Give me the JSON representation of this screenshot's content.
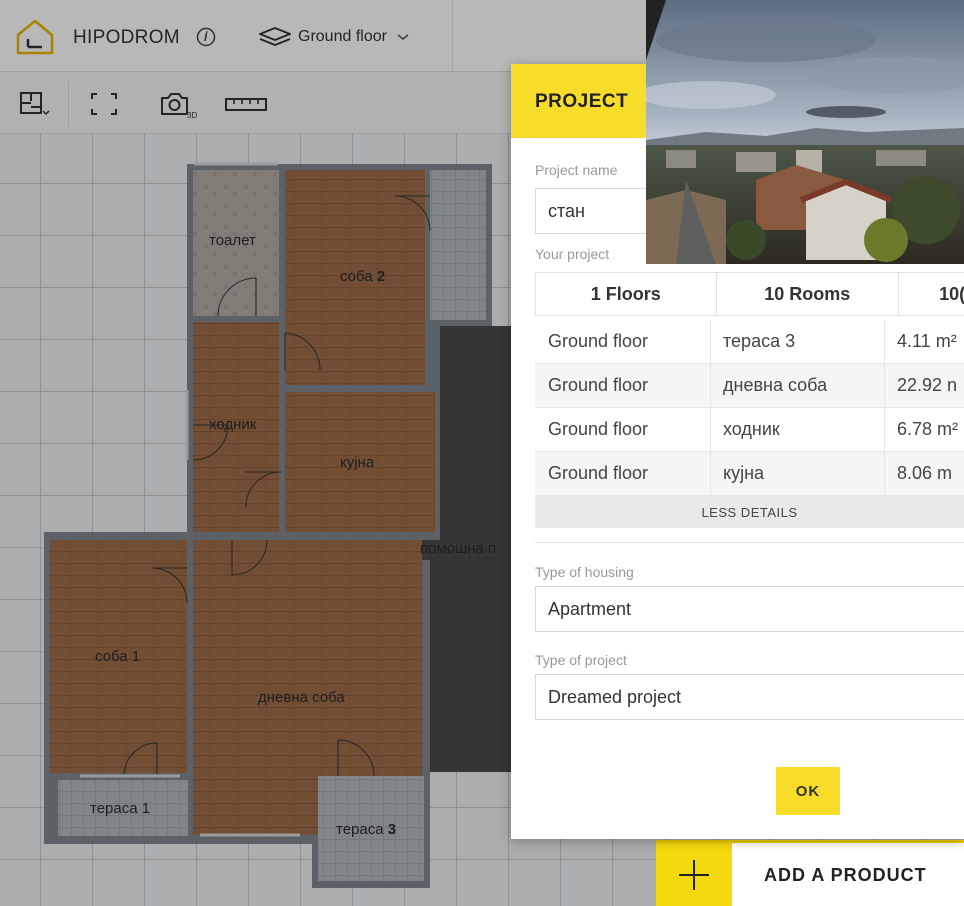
{
  "header": {
    "project_name": "HIPODROM",
    "floor_selector": "Ground floor"
  },
  "floorplan": {
    "rooms": [
      {
        "name": "тоалет"
      },
      {
        "name": "соба",
        "num": "2"
      },
      {
        "name": "ходник"
      },
      {
        "name": "кујна"
      },
      {
        "name": "помошна п"
      },
      {
        "name": "соба 1"
      },
      {
        "name": "дневна соба"
      },
      {
        "name": "тераса 1"
      },
      {
        "name": "тераса",
        "num": "3"
      }
    ]
  },
  "modal": {
    "title": "PROJECT",
    "project_name_label": "Project name",
    "project_name_value": "стан",
    "your_project_label": "Your project",
    "summary": {
      "floors": "1 Floors",
      "rooms": "10 Rooms",
      "area": "10("
    },
    "rooms_table": [
      {
        "floor": "Ground floor",
        "room": "тераса 3",
        "area": "4.11 m²"
      },
      {
        "floor": "Ground floor",
        "room": "дневна соба",
        "area": "22.92 n"
      },
      {
        "floor": "Ground floor",
        "room": "ходник",
        "area": "6.78 m²"
      },
      {
        "floor": "Ground floor",
        "room": "кујна",
        "area": "8.06 m"
      }
    ],
    "less_details": "LESS DETAILS",
    "housing_label": "Type of housing",
    "housing_value": "Apartment",
    "project_type_label": "Type of project",
    "project_type_value": "Dreamed project",
    "ok_label": "OK"
  },
  "add_product": {
    "label": "ADD A PRODUCT"
  },
  "colors": {
    "accent": "#f7dd2a",
    "wall": "#7f878e",
    "wood": "#9b6a45"
  }
}
